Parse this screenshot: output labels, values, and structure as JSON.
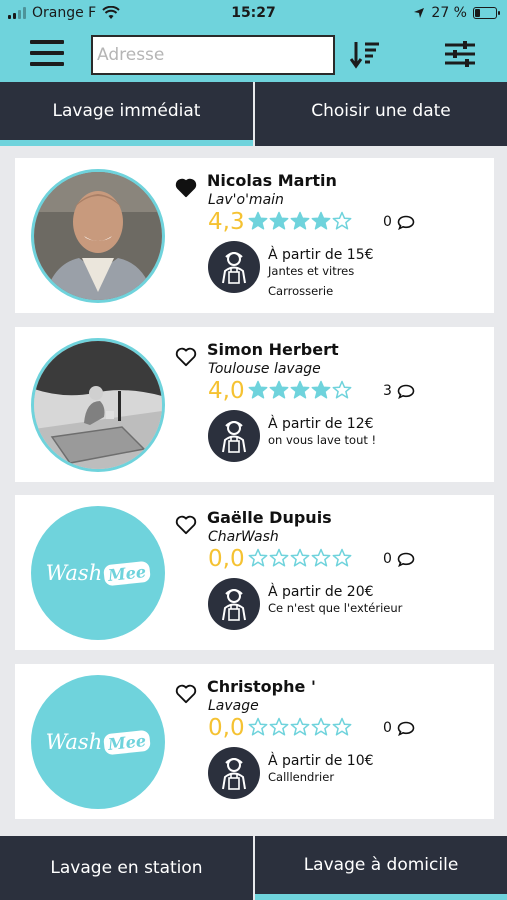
{
  "status_bar": {
    "carrier": "Orange F",
    "time": "15:27",
    "battery": "27 %",
    "battery_level": 0.27
  },
  "header": {
    "address_placeholder": "Adresse",
    "icons": [
      "menu-icon",
      "sort-icon",
      "filter-icon"
    ]
  },
  "top_tabs": [
    {
      "label": "Lavage immédiat",
      "active": true
    },
    {
      "label": "Choisir une date",
      "active": false
    }
  ],
  "washers": [
    {
      "name": "Nicolas Martin",
      "company": "Lav'o'main",
      "rating": "4,3",
      "stars": 4,
      "comments": "0",
      "favorite": true,
      "price": "À partir de 15€",
      "desc1": "Jantes et vitres",
      "desc2": "Carrosserie",
      "avatar": "photo-man"
    },
    {
      "name": "Simon Herbert",
      "company": "Toulouse lavage",
      "rating": "4,0",
      "stars": 4,
      "comments": "3",
      "favorite": false,
      "price": "À partir de 12€",
      "desc1": "on vous lave tout !",
      "desc2": "",
      "avatar": "photo-worker"
    },
    {
      "name": "Gaëlle Dupuis",
      "company": "CharWash",
      "rating": "0,0",
      "stars": 0,
      "comments": "0",
      "favorite": false,
      "price": "À partir de 20€",
      "desc1": "Ce n'est que l'extérieur",
      "desc2": "",
      "avatar": "logo"
    },
    {
      "name": "Christophe '",
      "company": "Lavage",
      "rating": "0,0",
      "stars": 0,
      "comments": "0",
      "favorite": false,
      "price": "À partir de 10€",
      "desc1": "Calllendrier",
      "desc2": "",
      "avatar": "logo"
    }
  ],
  "logo": {
    "text": "Wash",
    "badge": "Mee"
  },
  "bottom_tabs": [
    {
      "label": "Lavage en station",
      "active": false
    },
    {
      "label": "Lavage à domicile",
      "active": true
    }
  ],
  "colors": {
    "accent": "#6fd3dc",
    "dark": "#2b303d",
    "rating": "#f5c232",
    "background": "#e8e9ec"
  }
}
